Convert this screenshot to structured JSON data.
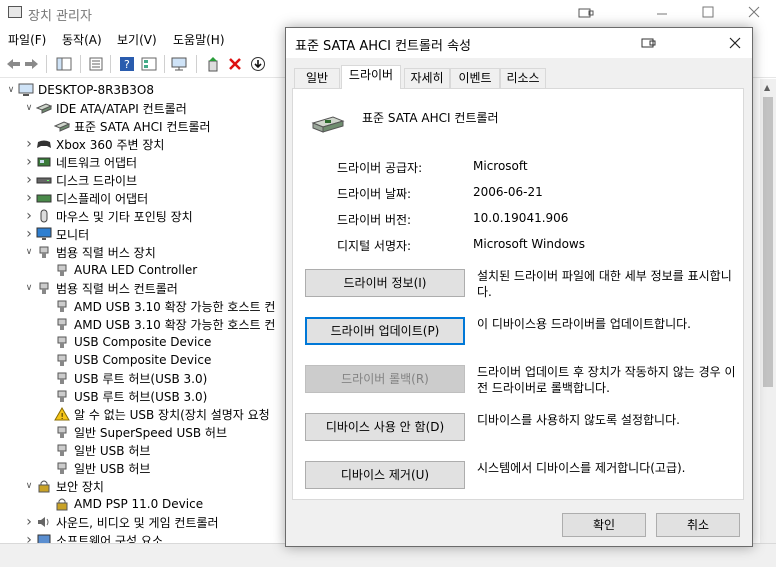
{
  "window": {
    "title": "장치 관리자"
  },
  "menu": [
    "파일(F)",
    "동작(A)",
    "보기(V)",
    "도움말(H)"
  ],
  "tree": {
    "root": "DESKTOP-8R3B3O8",
    "rows": [
      {
        "label": "IDE ATA/ATAPI 컨트롤러",
        "level": 1,
        "chevron": "v",
        "icon": "ide-controller-icon"
      },
      {
        "label": "표준 SATA AHCI 컨트롤러",
        "level": 2,
        "chevron": "",
        "icon": "ide-controller-icon"
      },
      {
        "label": "Xbox 360 주변 장치",
        "level": 1,
        "chevron": ">",
        "icon": "gamepad-icon"
      },
      {
        "label": "네트워크 어댑터",
        "level": 1,
        "chevron": ">",
        "icon": "network-adapter-icon"
      },
      {
        "label": "디스크 드라이브",
        "level": 1,
        "chevron": ">",
        "icon": "disk-drive-icon"
      },
      {
        "label": "디스플레이 어댑터",
        "level": 1,
        "chevron": ">",
        "icon": "display-adapter-icon"
      },
      {
        "label": "마우스 및 기타 포인팅 장치",
        "level": 1,
        "chevron": ">",
        "icon": "mouse-icon"
      },
      {
        "label": "모니터",
        "level": 1,
        "chevron": ">",
        "icon": "monitor-icon"
      },
      {
        "label": "범용 직렬 버스 장치",
        "level": 1,
        "chevron": "v",
        "icon": "usb-icon"
      },
      {
        "label": "AURA LED Controller",
        "level": 2,
        "chevron": "",
        "icon": "usb-icon"
      },
      {
        "label": "범용 직렬 버스 컨트롤러",
        "level": 1,
        "chevron": "v",
        "icon": "usb-icon"
      },
      {
        "label": "AMD USB 3.10 확장 가능한 호스트 컨",
        "level": 2,
        "chevron": "",
        "icon": "usb-icon"
      },
      {
        "label": "AMD USB 3.10 확장 가능한 호스트 컨",
        "level": 2,
        "chevron": "",
        "icon": "usb-icon"
      },
      {
        "label": "USB Composite Device",
        "level": 2,
        "chevron": "",
        "icon": "usb-icon"
      },
      {
        "label": "USB Composite Device",
        "level": 2,
        "chevron": "",
        "icon": "usb-icon"
      },
      {
        "label": "USB 루트 허브(USB 3.0)",
        "level": 2,
        "chevron": "",
        "icon": "usb-icon"
      },
      {
        "label": "USB 루트 허브(USB 3.0)",
        "level": 2,
        "chevron": "",
        "icon": "usb-icon"
      },
      {
        "label": "알 수 없는 USB 장치(장치 설명자 요청",
        "level": 2,
        "chevron": "",
        "icon": "warning-icon"
      },
      {
        "label": "일반 SuperSpeed USB 허브",
        "level": 2,
        "chevron": "",
        "icon": "usb-icon"
      },
      {
        "label": "일반 USB 허브",
        "level": 2,
        "chevron": "",
        "icon": "usb-icon"
      },
      {
        "label": "일반 USB 허브",
        "level": 2,
        "chevron": "",
        "icon": "usb-icon"
      },
      {
        "label": "보안 장치",
        "level": 1,
        "chevron": "v",
        "icon": "security-device-icon"
      },
      {
        "label": "AMD PSP 11.0 Device",
        "level": 2,
        "chevron": "",
        "icon": "security-device-icon"
      },
      {
        "label": "사운드, 비디오 및 게임 컨트롤러",
        "level": 1,
        "chevron": ">",
        "icon": "speaker-icon"
      },
      {
        "label": "소프트웨어 구성 요소",
        "level": 1,
        "chevron": ">",
        "icon": "software-component-icon"
      }
    ]
  },
  "dialog": {
    "title": "표준 SATA AHCI 컨트롤러 속성",
    "tabs": [
      "일반",
      "드라이버",
      "자세히",
      "이벤트",
      "리소스"
    ],
    "active_tab": "드라이버",
    "device_name": "표준 SATA AHCI 컨트롤러",
    "properties": [
      {
        "label": "드라이버 공급자:",
        "value": "Microsoft"
      },
      {
        "label": "드라이버 날짜:",
        "value": "2006-06-21"
      },
      {
        "label": "드라이버 버전:",
        "value": "10.0.19041.906"
      },
      {
        "label": "디지털 서명자:",
        "value": "Microsoft Windows"
      }
    ],
    "actions": [
      {
        "button": "드라이버 정보(I)",
        "desc": "설치된 드라이버 파일에 대한 세부 정보를 표시합니다.",
        "enabled": true
      },
      {
        "button": "드라이버 업데이트(P)",
        "desc": "이 디바이스용 드라이버를 업데이트합니다.",
        "enabled": true
      },
      {
        "button": "드라이버 롤백(R)",
        "desc": "드라이버 업데이트 후 장치가 작동하지 않는 경우 이전 드라이버로 롤백합니다.",
        "enabled": false
      },
      {
        "button": "디바이스 사용 안 함(D)",
        "desc": "디바이스를 사용하지 않도록 설정합니다.",
        "enabled": true
      },
      {
        "button": "디바이스 제거(U)",
        "desc": "시스템에서 디바이스를 제거합니다(고급).",
        "enabled": true
      }
    ],
    "ok_label": "확인",
    "cancel_label": "취소"
  }
}
